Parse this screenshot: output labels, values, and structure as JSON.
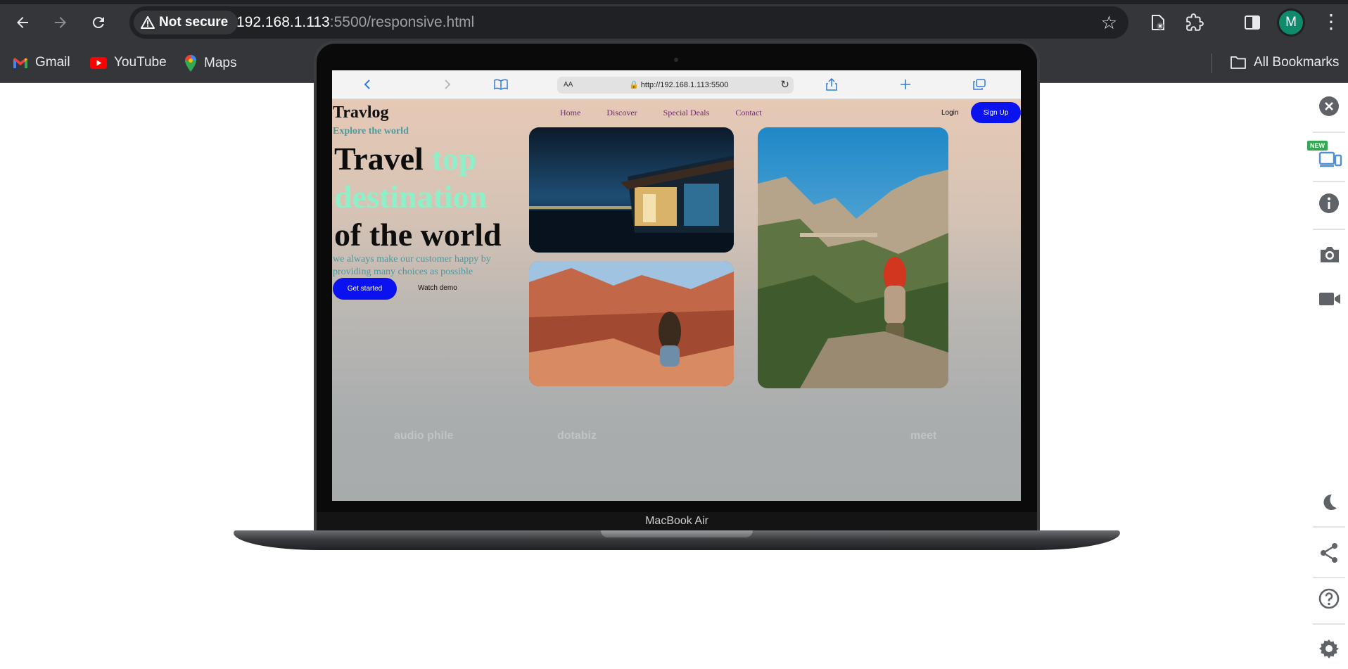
{
  "browser": {
    "security_label": "Not secure",
    "url_host": "192.168.1.113",
    "url_rest": ":5500/responsive.html",
    "profile_initial": "M",
    "bookmarks": [
      {
        "label": "Gmail",
        "icon": "gmail-icon"
      },
      {
        "label": "YouTube",
        "icon": "youtube-icon"
      },
      {
        "label": "Maps",
        "icon": "maps-icon"
      }
    ],
    "all_bookmarks_label": "All Bookmarks"
  },
  "device": {
    "model_label": "MacBook Air",
    "safari": {
      "aa_label": "AA",
      "url": "http://192.168.1.113:5500"
    }
  },
  "site": {
    "brand": "Travlog",
    "nav": [
      "Home",
      "Discover",
      "Special Deals",
      "Contact"
    ],
    "login_label": "Login",
    "signup_label": "Sign Up",
    "eyebrow": "Explore the world",
    "hero_line1": "Travel ",
    "hero_accent": "top destination",
    "hero_line3": "of the world",
    "lead": "we always make our customer happy by providing many choices as possible",
    "start_label": "Get started",
    "demo_label": "Watch demo",
    "partner_logos": [
      "audio phile",
      "dotabiz",
      "meet"
    ],
    "colors": {
      "primary": "#0a12f0",
      "accent": "#8ef0c8",
      "teal": "#4a9aa0",
      "nav": "#6b2a6e"
    }
  },
  "sidebar": {
    "new_badge": "NEW",
    "icons": [
      "close-icon",
      "responsive-devices-icon",
      "info-icon",
      "camera-icon",
      "video-icon",
      "dark-mode-icon",
      "share-icon",
      "help-icon",
      "settings-icon"
    ]
  }
}
